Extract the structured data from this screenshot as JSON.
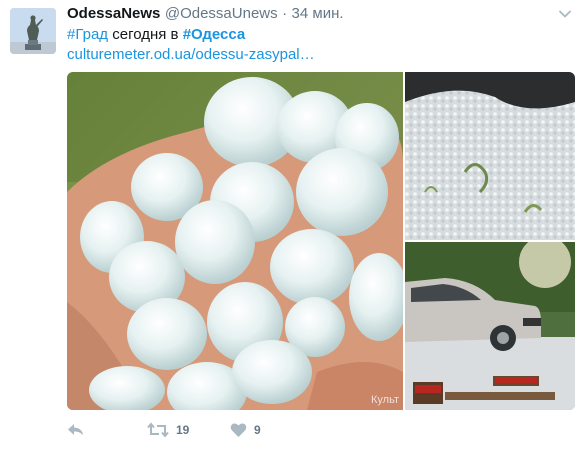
{
  "tweet": {
    "display_name": "OdessaNews",
    "handle": "@OdessaUnews",
    "separator": "·",
    "time": "34 мин.",
    "hashtag_1": "#Град",
    "text_middle": " сегодня в ",
    "hashtag_2": "#Одесса",
    "link": "culturemeter.od.ua/odessu-zasypal…"
  },
  "media": {
    "watermark": "Культ"
  },
  "actions": {
    "retweets": "19",
    "likes": "9"
  },
  "colors": {
    "link": "#1b95e0",
    "secondary": "#657786",
    "text": "#14171a"
  },
  "icons": {
    "menu": "chevron-down-icon",
    "reply": "reply-icon",
    "retweet": "retweet-icon",
    "like": "heart-icon"
  }
}
